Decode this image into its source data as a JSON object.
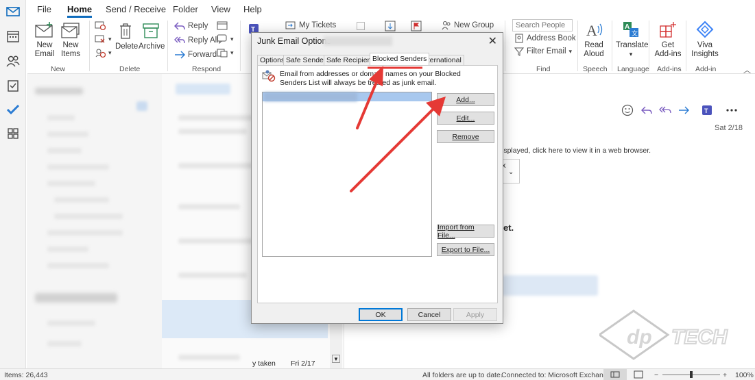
{
  "tabs": [
    "File",
    "Home",
    "Send / Receive",
    "Folder",
    "View",
    "Help"
  ],
  "active_tab": "Home",
  "ribbon": {
    "new_email": "New\nEmail",
    "new_items": "New\nItems",
    "group_new": "New",
    "delete": "Delete",
    "archive": "Archive",
    "group_delete": "Delete",
    "reply": "Reply",
    "reply_all": "Reply All",
    "forward": "Forward",
    "group_respond": "Respond",
    "my_tickets": "My Tickets",
    "new_group": "New Group",
    "search_people_placeholder": "Search People",
    "address_book": "Address Book",
    "filter_email": "Filter Email",
    "group_find": "Find",
    "read_aloud": "Read\nAloud",
    "group_speech": "Speech",
    "translate": "Translate",
    "group_language": "Language",
    "get_addins": "Get\nAdd-ins",
    "group_addins": "Add-ins",
    "viva_insights": "Viva\nInsights",
    "group_addin": "Add-in"
  },
  "reading_pane": {
    "date": "Sat 2/18",
    "info_text": "isplayed, click here to view it in a web browser.",
    "fragment_x": "x",
    "fragment_et": "et."
  },
  "message_list": {
    "last_item_text": "y taken",
    "last_item_date": "Fri 2/17"
  },
  "status": {
    "items": "Items: 26,443",
    "sync": "All folders are up to date.",
    "connection": "Connected to: Microsoft Exchange",
    "zoom": "100%"
  },
  "dialog": {
    "title": "Junk Email Options -",
    "tabs": [
      "Options",
      "Safe Senders",
      "Safe Recipients",
      "Blocked Senders",
      "International"
    ],
    "active_tab": "Blocked Senders",
    "description": "Email from addresses or domain names on your Blocked Senders List will always be treated as junk email.",
    "add": "Add...",
    "edit": "Edit...",
    "remove": "Remove",
    "import": "Import from File...",
    "export": "Export to File...",
    "ok": "OK",
    "cancel": "Cancel",
    "apply": "Apply"
  },
  "colors": {
    "accent": "#0f6cbd",
    "annotation_arrow": "#e53935",
    "selection": "#a8c8ee"
  }
}
